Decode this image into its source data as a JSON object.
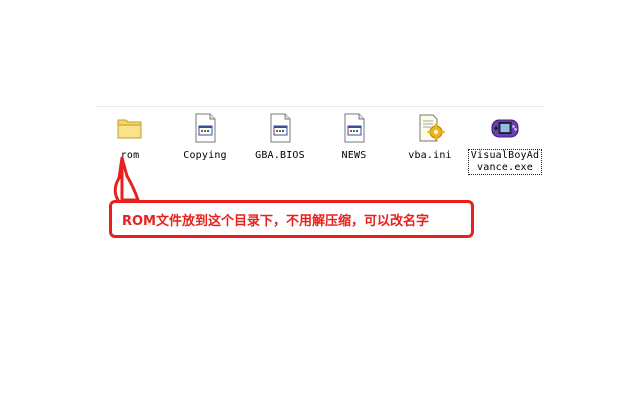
{
  "files": [
    {
      "name": "rom",
      "icon": "folder-icon"
    },
    {
      "name": "Copying",
      "icon": "document-icon"
    },
    {
      "name": "GBA.BIOS",
      "icon": "document-icon"
    },
    {
      "name": "NEWS",
      "icon": "document-icon"
    },
    {
      "name": "vba.ini",
      "icon": "config-file-icon"
    },
    {
      "name": "VisualBoyAdvance.exe",
      "label_line1": "VisualBoyAd",
      "label_line2": "vance.exe",
      "icon": "gameboy-advance-icon",
      "selected": true
    }
  ],
  "annotation": {
    "text": "ROM文件放到这个目录下，不用解压缩，可以改名字",
    "color": "#e8201e"
  }
}
